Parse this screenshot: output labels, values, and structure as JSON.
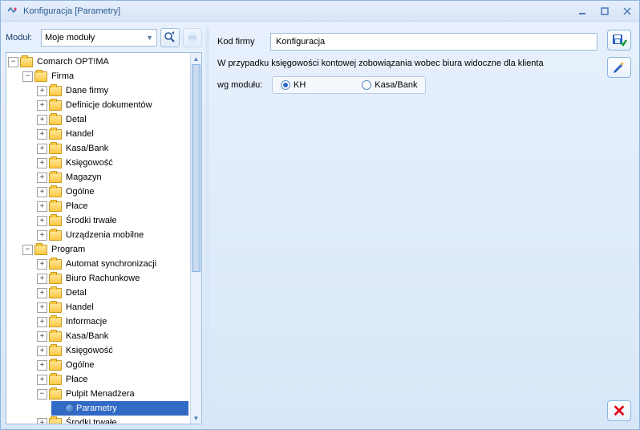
{
  "title": "Konfiguracja [Parametry]",
  "module_label": "Moduł:",
  "module_value": "Moje moduły",
  "tree": {
    "root": "Comarch OPT!MA",
    "firma": "Firma",
    "firma_items": [
      "Dane firmy",
      "Definicje dokumentów",
      "Detal",
      "Handel",
      "Kasa/Bank",
      "Księgowość",
      "Magazyn",
      "Ogólne",
      "Płace",
      "Środki trwałe",
      "Urządzenia mobilne"
    ],
    "program": "Program",
    "program_items": [
      "Automat synchronizacji",
      "Biuro Rachunkowe",
      "Detal",
      "Handel",
      "Informacje",
      "Kasa/Bank",
      "Księgowość",
      "Ogólne",
      "Płace"
    ],
    "pulpit": "Pulpit Menadżera",
    "parametry": "Parametry",
    "srodki": "Środki trwałe"
  },
  "right": {
    "kod_firmy_label": "Kod firmy",
    "kod_firmy_value": "Konfiguracja",
    "info": "W przypadku księgowości kontowej zobowiązania wobec biura widoczne dla klienta",
    "wg_label": "wg modułu:",
    "opt_kh": "KH",
    "opt_kb": "Kasa/Bank"
  }
}
